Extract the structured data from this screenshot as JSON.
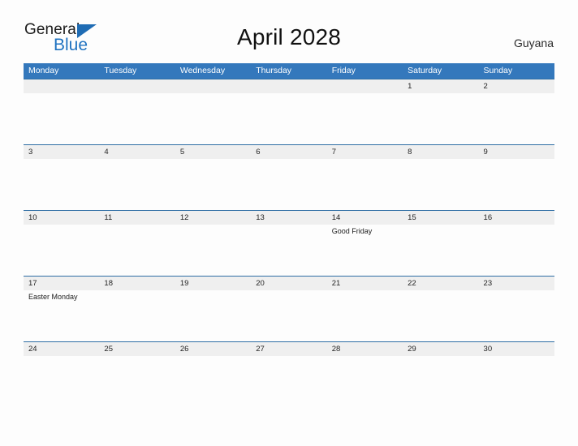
{
  "brand": {
    "name_part1": "General",
    "name_part2": "Blue",
    "triangle_icon": "triangle-icon",
    "accent_color": "#1f72c0"
  },
  "header": {
    "title": "April 2028",
    "country": "Guyana"
  },
  "theme": {
    "header_blue": "#3478bc",
    "row_line_blue": "#2e6da4",
    "date_band_gray": "#efefef",
    "page_background": "#fdfdfd"
  },
  "calendar": {
    "weekdays": [
      "Monday",
      "Tuesday",
      "Wednesday",
      "Thursday",
      "Friday",
      "Saturday",
      "Sunday"
    ],
    "weeks": [
      {
        "days": [
          {
            "date": "",
            "event": ""
          },
          {
            "date": "",
            "event": ""
          },
          {
            "date": "",
            "event": ""
          },
          {
            "date": "",
            "event": ""
          },
          {
            "date": "",
            "event": ""
          },
          {
            "date": "1",
            "event": ""
          },
          {
            "date": "2",
            "event": ""
          }
        ]
      },
      {
        "days": [
          {
            "date": "3",
            "event": ""
          },
          {
            "date": "4",
            "event": ""
          },
          {
            "date": "5",
            "event": ""
          },
          {
            "date": "6",
            "event": ""
          },
          {
            "date": "7",
            "event": ""
          },
          {
            "date": "8",
            "event": ""
          },
          {
            "date": "9",
            "event": ""
          }
        ]
      },
      {
        "days": [
          {
            "date": "10",
            "event": ""
          },
          {
            "date": "11",
            "event": ""
          },
          {
            "date": "12",
            "event": ""
          },
          {
            "date": "13",
            "event": ""
          },
          {
            "date": "14",
            "event": "Good Friday"
          },
          {
            "date": "15",
            "event": ""
          },
          {
            "date": "16",
            "event": ""
          }
        ]
      },
      {
        "days": [
          {
            "date": "17",
            "event": "Easter Monday"
          },
          {
            "date": "18",
            "event": ""
          },
          {
            "date": "19",
            "event": ""
          },
          {
            "date": "20",
            "event": ""
          },
          {
            "date": "21",
            "event": ""
          },
          {
            "date": "22",
            "event": ""
          },
          {
            "date": "23",
            "event": ""
          }
        ]
      },
      {
        "days": [
          {
            "date": "24",
            "event": ""
          },
          {
            "date": "25",
            "event": ""
          },
          {
            "date": "26",
            "event": ""
          },
          {
            "date": "27",
            "event": ""
          },
          {
            "date": "28",
            "event": ""
          },
          {
            "date": "29",
            "event": ""
          },
          {
            "date": "30",
            "event": ""
          }
        ]
      }
    ]
  }
}
